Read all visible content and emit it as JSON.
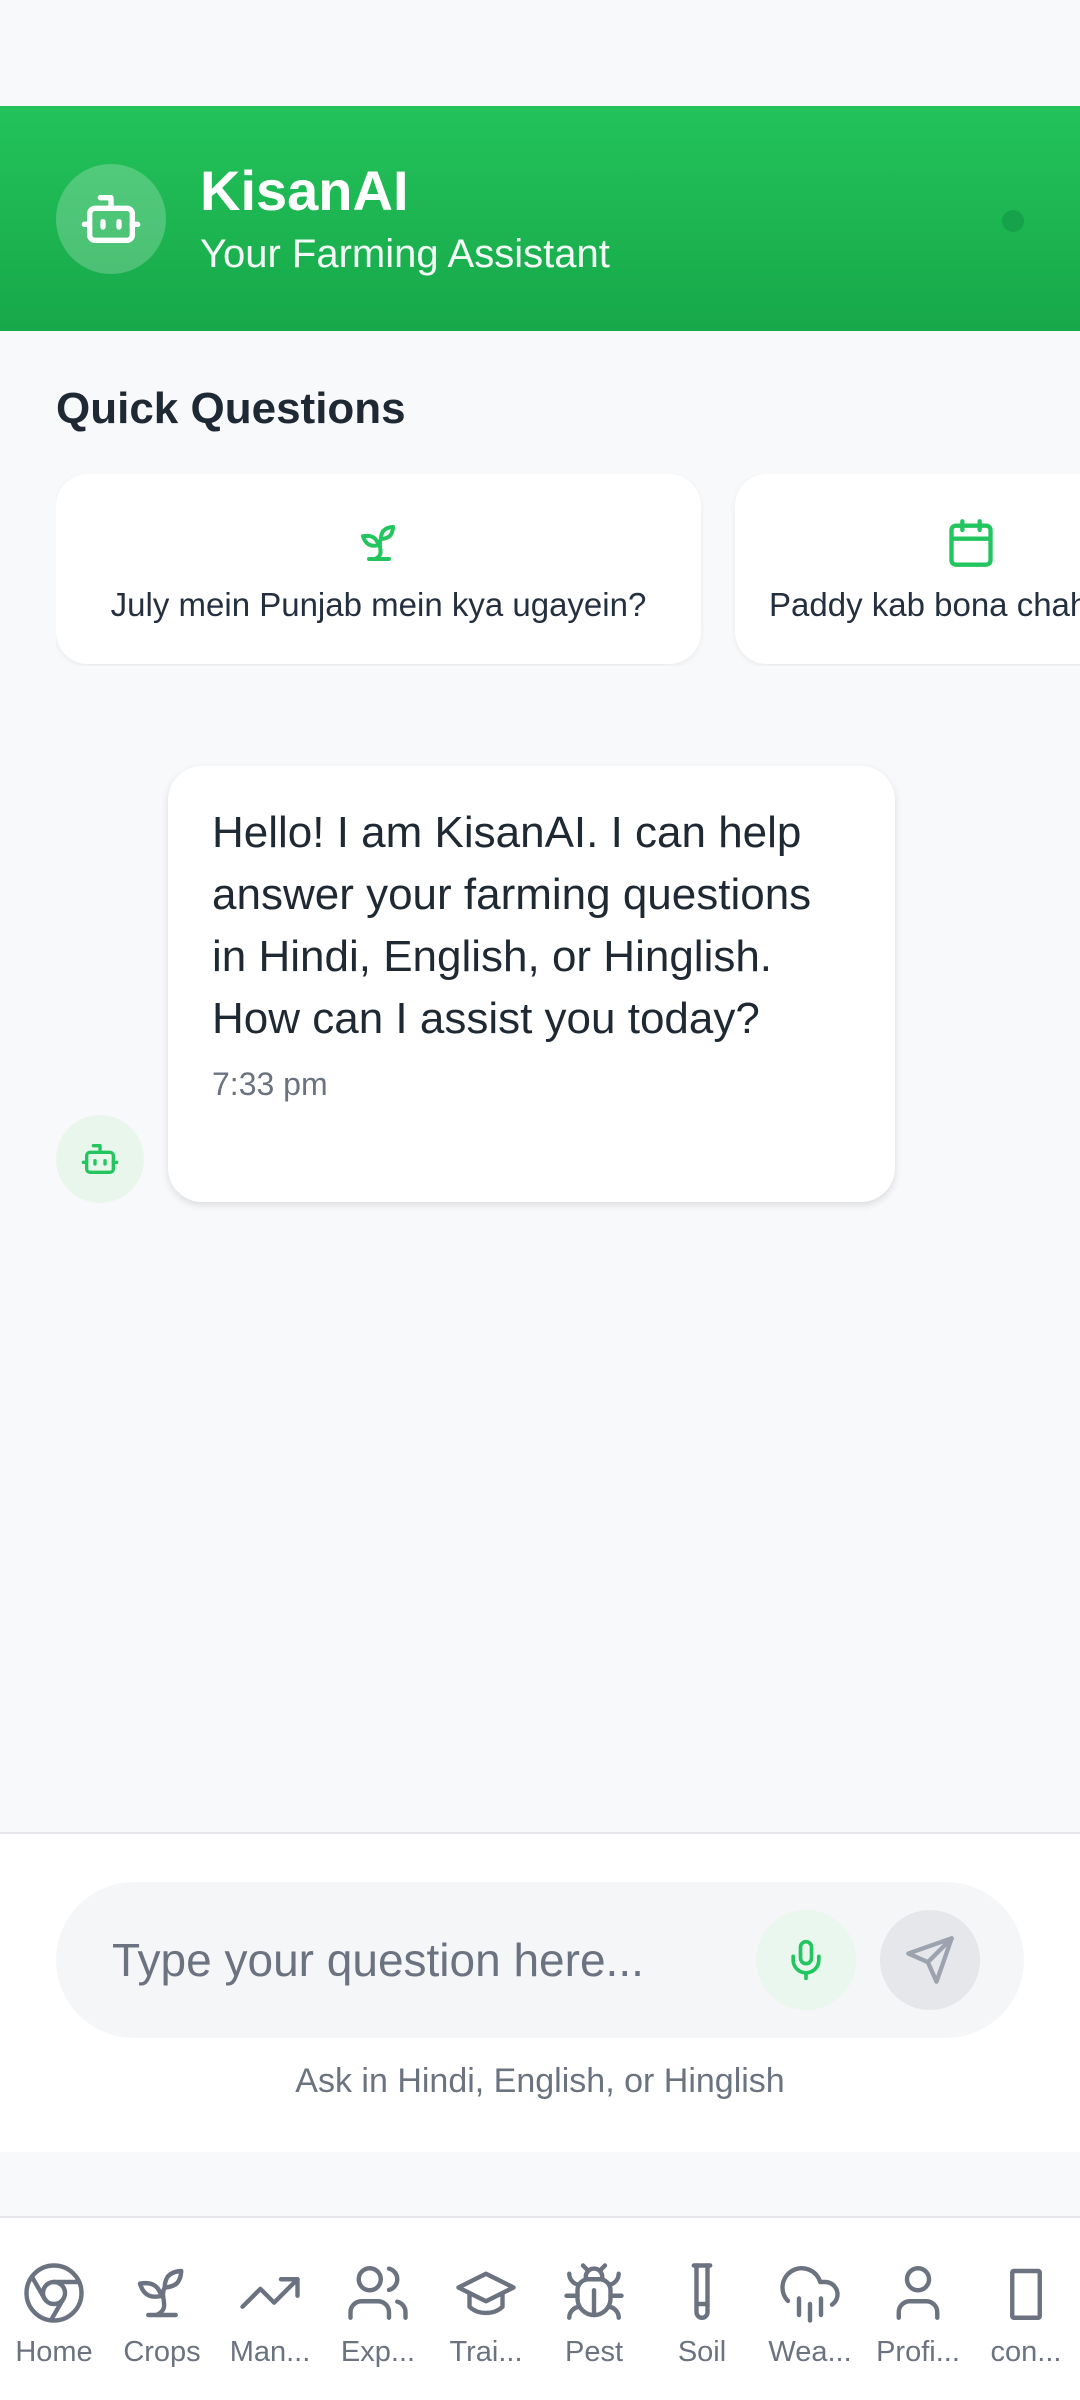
{
  "header": {
    "title": "KisanAI",
    "subtitle": "Your Farming Assistant",
    "avatar_icon": "robot-icon",
    "status": "online"
  },
  "quick_questions": {
    "title": "Quick Questions",
    "items": [
      {
        "icon": "sprout-icon",
        "label": "July mein Punjab mein kya ugayein?"
      },
      {
        "icon": "calendar-icon",
        "label": "Paddy kab bona chahiye?"
      }
    ]
  },
  "messages": [
    {
      "sender": "bot",
      "text": "Hello! I am KisanAI. I can help answer your farming questions in Hindi, English, or Hinglish. How can I assist you today?",
      "time": "7:33 pm"
    }
  ],
  "composer": {
    "placeholder": "Type your question here...",
    "helper": "Ask in Hindi, English, or Hinglish",
    "mic_icon": "microphone-icon",
    "send_icon": "send-icon"
  },
  "bottom_nav": {
    "items": [
      {
        "label": "Home",
        "icon": "home-icon"
      },
      {
        "label": "Crops",
        "icon": "sprout-icon"
      },
      {
        "label": "Man...",
        "icon": "trending-up-icon"
      },
      {
        "label": "Exp...",
        "icon": "users-icon"
      },
      {
        "label": "Trai...",
        "icon": "graduation-cap-icon"
      },
      {
        "label": "Pest",
        "icon": "bug-icon"
      },
      {
        "label": "Soil",
        "icon": "test-tube-icon"
      },
      {
        "label": "Wea...",
        "icon": "cloud-rain-icon"
      },
      {
        "label": "Profi...",
        "icon": "user-icon"
      },
      {
        "label": "con...",
        "icon": "device-icon"
      }
    ]
  },
  "colors": {
    "primary": "#22c55e",
    "primary_dark": "#16a34a",
    "background": "#f8f9fb",
    "muted_text": "#6b7280"
  }
}
